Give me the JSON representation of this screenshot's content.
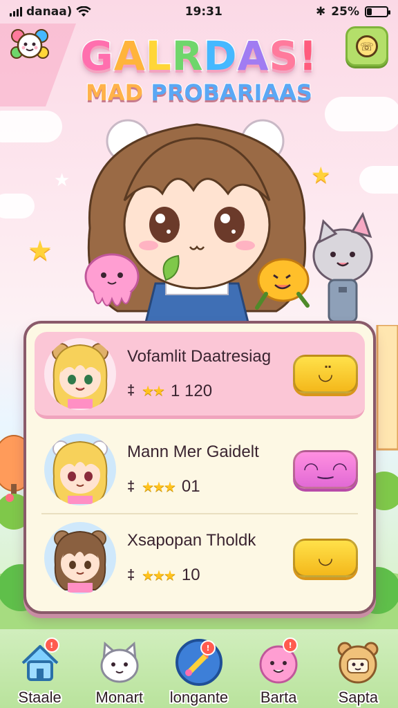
{
  "status_bar": {
    "carrier": "danaa)",
    "time": "19:31",
    "battery_percent": "25%",
    "battery_level": 0.25
  },
  "header": {
    "title_line1": "GALRDAS!",
    "title_line2": "MAD PROBARIAAS",
    "menu_icon": "phone-icon"
  },
  "list": {
    "entries": [
      {
        "name": "Vofamlit Daatresiag",
        "stars": 2,
        "score": "1 120",
        "action_icon": "happy-face-icon",
        "action_color": "#f4b81b"
      },
      {
        "name": "Mann Mer Gaidelt",
        "stars": 3,
        "score": "01",
        "action_icon": "laughing-face-icon",
        "action_color": "#e26ad5"
      },
      {
        "name": "Xsapopan Tholdk",
        "stars": 3,
        "score": "10",
        "action_icon": "smile-face-icon",
        "action_color": "#f4b81b"
      }
    ]
  },
  "nav": {
    "items": [
      {
        "label": "Staale",
        "icon": "house-icon",
        "badge": true
      },
      {
        "label": "Monart",
        "icon": "cat-face-icon",
        "badge": false
      },
      {
        "label": "longante",
        "icon": "brush-icon",
        "badge": true
      },
      {
        "label": "Barta",
        "icon": "bunny-face-icon",
        "badge": true
      },
      {
        "label": "Sapta",
        "icon": "bear-face-icon",
        "badge": false
      }
    ]
  },
  "colors": {
    "panel_border": "#8a5a6a",
    "first_row_bg": "#fbc6d6",
    "accent_yellow": "#f4b81b",
    "accent_pink": "#e26ad5"
  }
}
